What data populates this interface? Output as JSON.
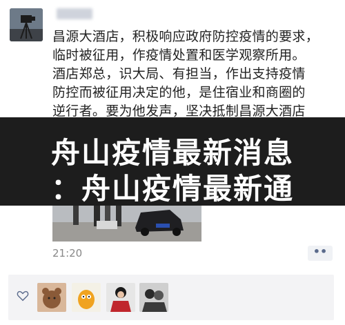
{
  "post": {
    "lines": [
      "昌源大酒店，积极响应政府防控疫情的要求，",
      "临时被征用，作疫情处置和医学观察所用。",
      "酒店郑总，识大局、有担当，作出支持疫情",
      "防控而被征用决定的他，是住宿业和商圈的",
      "逆行者。要为他发声，坚决抵制昌源大酒店"
    ],
    "time": "21:20",
    "more_label": "••"
  },
  "overlay": {
    "line1": "舟山疫情最新消息",
    "line2": "：舟山疫情最新通"
  },
  "icons": {
    "like": "heart-icon",
    "more": "more-dots-icon"
  },
  "colors": {
    "banner_bg": "#1d1d1d",
    "banner_text": "#ffffff",
    "more_dots": "#5b6b8c",
    "likes_bg": "#f3f3f5"
  }
}
